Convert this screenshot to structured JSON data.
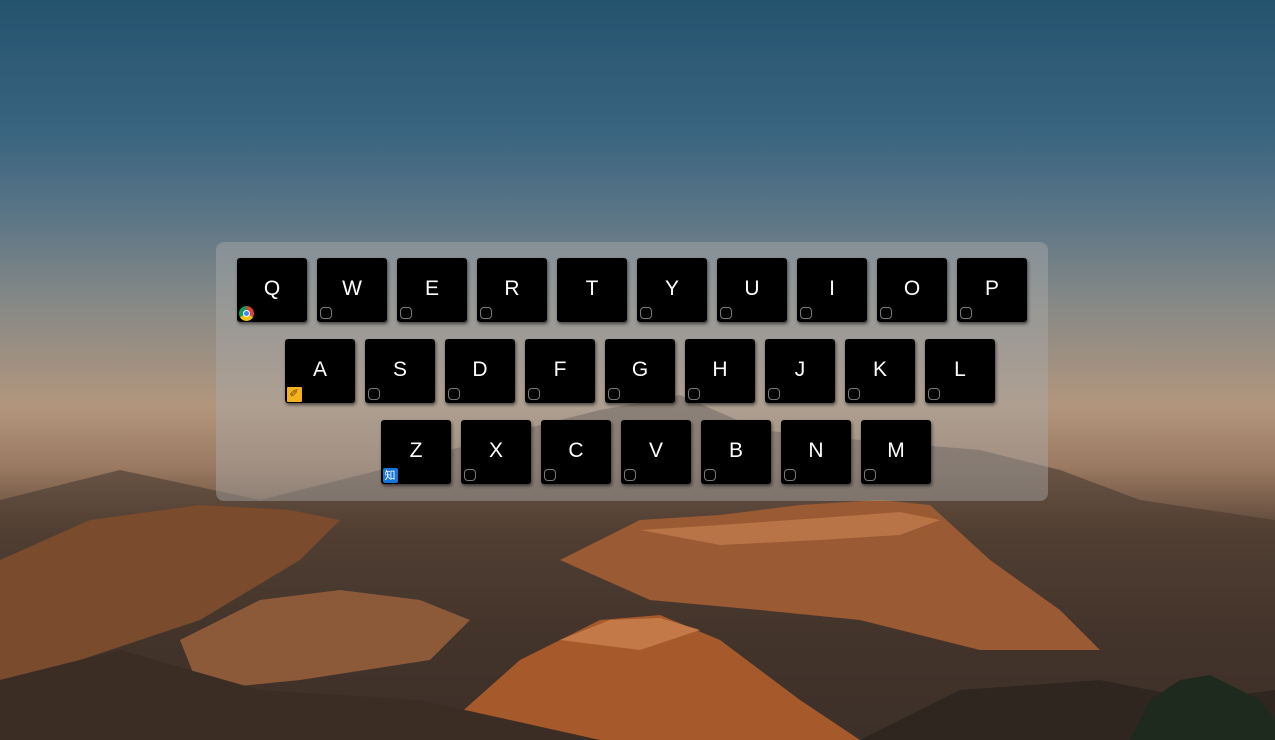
{
  "wallpaper": {
    "description_icon": "volcano-landscape-wallpaper"
  },
  "keyboard": {
    "rows": [
      {
        "keys": [
          {
            "letter": "Q",
            "icon": "chrome-icon"
          },
          {
            "letter": "W",
            "icon": "empty-slot"
          },
          {
            "letter": "E",
            "icon": "empty-slot"
          },
          {
            "letter": "R",
            "icon": "empty-slot"
          },
          {
            "letter": "T",
            "icon": "none"
          },
          {
            "letter": "Y",
            "icon": "empty-slot"
          },
          {
            "letter": "U",
            "icon": "empty-slot"
          },
          {
            "letter": "I",
            "icon": "empty-slot"
          },
          {
            "letter": "O",
            "icon": "empty-slot"
          },
          {
            "letter": "P",
            "icon": "empty-slot"
          }
        ]
      },
      {
        "keys": [
          {
            "letter": "A",
            "icon": "sketch-icon"
          },
          {
            "letter": "S",
            "icon": "empty-slot"
          },
          {
            "letter": "D",
            "icon": "empty-slot"
          },
          {
            "letter": "F",
            "icon": "empty-slot"
          },
          {
            "letter": "G",
            "icon": "empty-slot"
          },
          {
            "letter": "H",
            "icon": "empty-slot"
          },
          {
            "letter": "J",
            "icon": "empty-slot"
          },
          {
            "letter": "K",
            "icon": "empty-slot"
          },
          {
            "letter": "L",
            "icon": "empty-slot"
          }
        ]
      },
      {
        "keys": [
          {
            "letter": "Z",
            "icon": "zhihu-icon",
            "icon_text": "知"
          },
          {
            "letter": "X",
            "icon": "empty-slot"
          },
          {
            "letter": "C",
            "icon": "empty-slot"
          },
          {
            "letter": "V",
            "icon": "empty-slot"
          },
          {
            "letter": "B",
            "icon": "empty-slot"
          },
          {
            "letter": "N",
            "icon": "empty-slot"
          },
          {
            "letter": "M",
            "icon": "empty-slot"
          }
        ]
      }
    ]
  },
  "colors": {
    "key_background": "#000000",
    "key_text": "#ffffff",
    "chrome_center": "#4285f4",
    "sketch_bg": "#f2b31d",
    "zhihu_bg": "#1476d8"
  }
}
